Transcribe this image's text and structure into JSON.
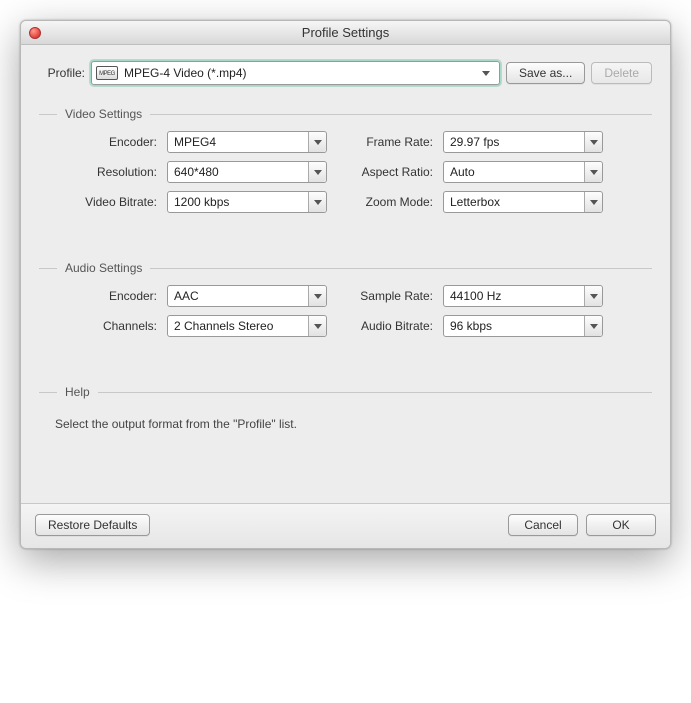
{
  "window": {
    "title": "Profile Settings"
  },
  "profile": {
    "label": "Profile:",
    "icon_text": "MPEG",
    "value": "MPEG-4 Video (*.mp4)",
    "save_as": "Save as...",
    "delete": "Delete"
  },
  "video": {
    "group_title": "Video Settings",
    "encoder_label": "Encoder:",
    "encoder_value": "MPEG4",
    "framerate_label": "Frame Rate:",
    "framerate_value": "29.97 fps",
    "resolution_label": "Resolution:",
    "resolution_value": "640*480",
    "aspect_label": "Aspect Ratio:",
    "aspect_value": "Auto",
    "vbitrate_label": "Video Bitrate:",
    "vbitrate_value": "1200 kbps",
    "zoom_label": "Zoom Mode:",
    "zoom_value": "Letterbox"
  },
  "audio": {
    "group_title": "Audio Settings",
    "encoder_label": "Encoder:",
    "encoder_value": "AAC",
    "samplerate_label": "Sample Rate:",
    "samplerate_value": "44100 Hz",
    "channels_label": "Channels:",
    "channels_value": "2 Channels Stereo",
    "abitrate_label": "Audio Bitrate:",
    "abitrate_value": "96 kbps"
  },
  "help": {
    "group_title": "Help",
    "text": "Select the output format from the \"Profile\" list."
  },
  "footer": {
    "restore": "Restore Defaults",
    "cancel": "Cancel",
    "ok": "OK"
  }
}
